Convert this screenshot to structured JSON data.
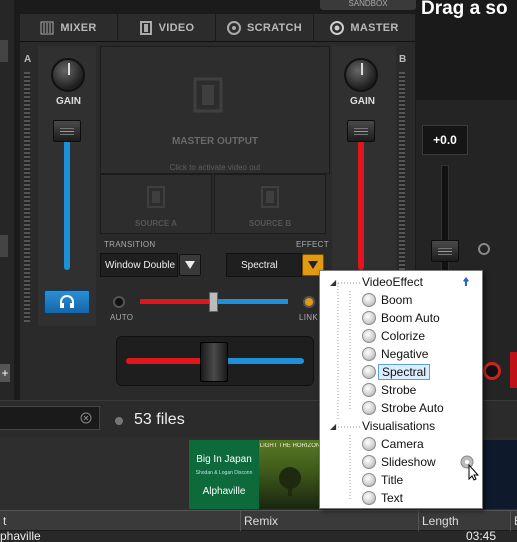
{
  "header": {
    "tabs": [
      {
        "label": "MIXER",
        "icon": "mixer-icon"
      },
      {
        "label": "VIDEO",
        "icon": "film-icon"
      },
      {
        "label": "SCRATCH",
        "icon": "vinyl-icon"
      },
      {
        "label": "MASTER",
        "icon": "master-icon"
      }
    ],
    "sandbox_label": "SANDBOX",
    "right_deck_title": "Drag a so"
  },
  "mixer": {
    "deck_a_letter": "A",
    "deck_b_letter": "B",
    "gain_label": "GAIN",
    "master_output_label": "MASTER OUTPUT",
    "master_output_hint": "Click to activate video out",
    "source_a_label": "SOURCE A",
    "source_b_label": "SOURCE B",
    "transition_label": "TRANSITION",
    "effect_label": "EFFECT",
    "transition_value": "Window Double",
    "effect_value": "Spectral",
    "auto_label": "AUTO",
    "link_label": "LINK",
    "colors": {
      "deck_a": "#1e90d8",
      "deck_b": "#e0161c",
      "effect_arrow": "#e29a12"
    }
  },
  "right_deck": {
    "pitch_value": "+0.0"
  },
  "browser": {
    "file_count": "53 files",
    "thumbnails": [
      {
        "title": "Big In Japan",
        "subtitle": "Shodan & Logan Disconn",
        "artist": "Alphaville"
      },
      {
        "title": "LIGHT THE HORIZON",
        "subtitle": "",
        "artist": ""
      }
    ],
    "columns": [
      "t",
      "Remix",
      "Length",
      "B"
    ],
    "row": {
      "artist": "phaville",
      "length": "03:45"
    }
  },
  "effect_menu": {
    "groups": [
      {
        "label": "VideoEffect",
        "items": [
          "Boom",
          "Boom Auto",
          "Colorize",
          "Negative",
          "Spectral",
          "Strobe",
          "Strobe Auto"
        ],
        "selected": "Spectral"
      },
      {
        "label": "Visualisations",
        "items": [
          "Camera",
          "Slideshow",
          "Title",
          "Text"
        ]
      }
    ]
  }
}
